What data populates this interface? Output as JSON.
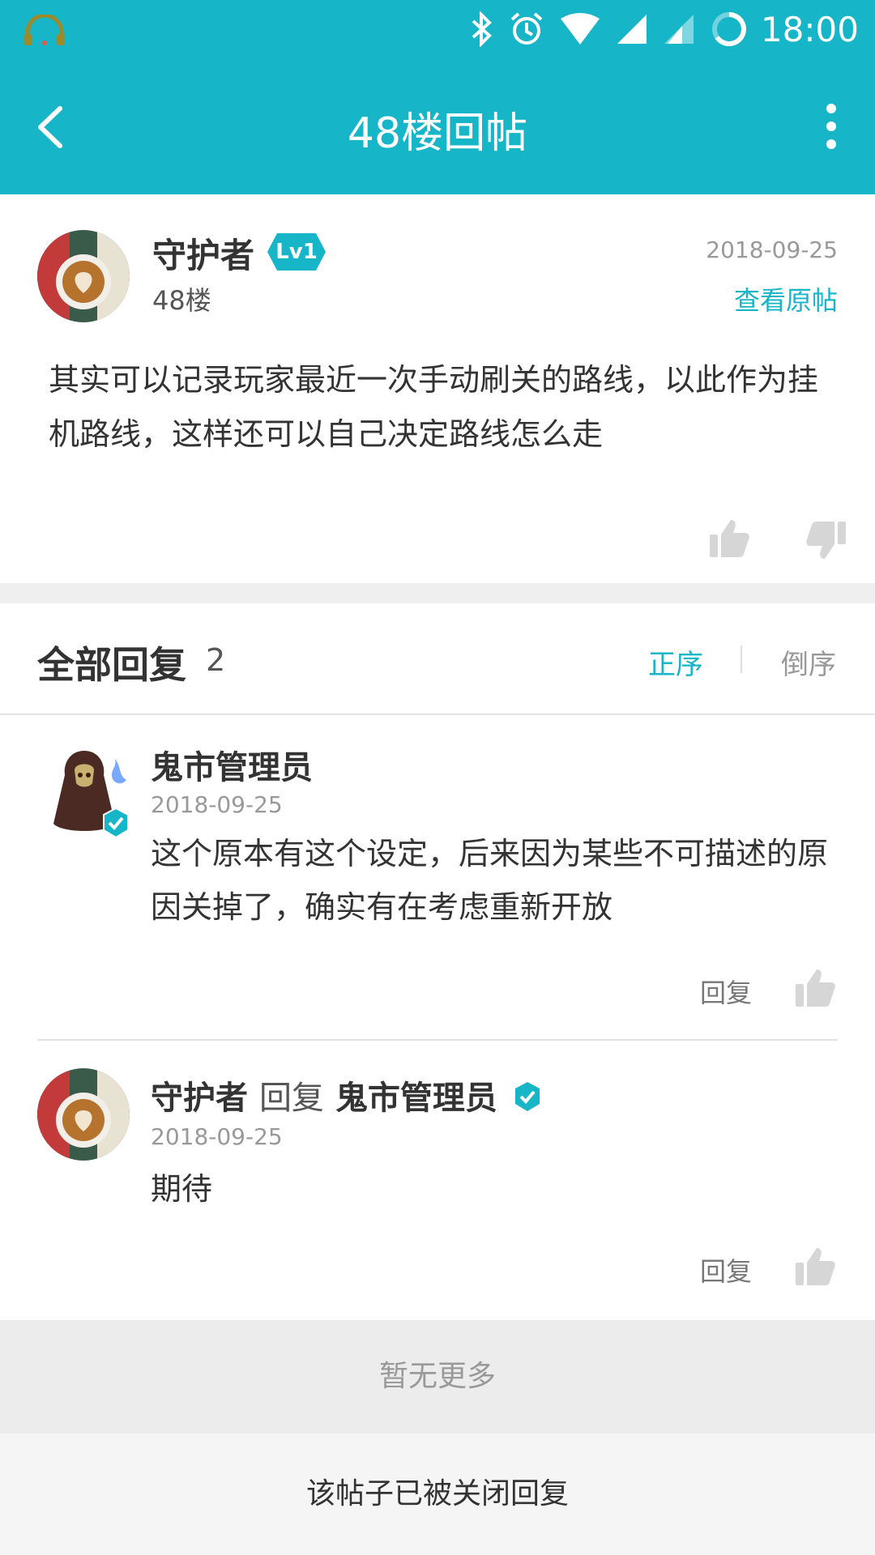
{
  "status_bar": {
    "time": "18:00"
  },
  "app_bar": {
    "title": "48楼回帖"
  },
  "post": {
    "author": "守护者",
    "level": "Lv1",
    "floor": "48楼",
    "date": "2018-09-25",
    "view_original": "查看原帖",
    "body": "其实可以记录玩家最近一次手动刷关的路线，以此作为挂机路线，这样还可以自己决定路线怎么走"
  },
  "replies": {
    "heading": "全部回复",
    "count": "2",
    "sort_asc": "正序",
    "sort_desc": "倒序",
    "items": [
      {
        "name": "鬼市管理员",
        "date": "2018-09-25",
        "body": "这个原本有这个设定，后来因为某些不可描述的原因关掉了，确实有在考虑重新开放",
        "reply_label": "回复"
      },
      {
        "name": "守护者",
        "reply_word": "回复",
        "reply_to": "鬼市管理员",
        "date": "2018-09-25",
        "body": "期待",
        "reply_label": "回复"
      }
    ]
  },
  "no_more": "暂无更多",
  "closed_notice": "该帖子已被关闭回复",
  "colors": {
    "accent": "#16b5c8",
    "text": "#333333",
    "muted": "#999999"
  }
}
